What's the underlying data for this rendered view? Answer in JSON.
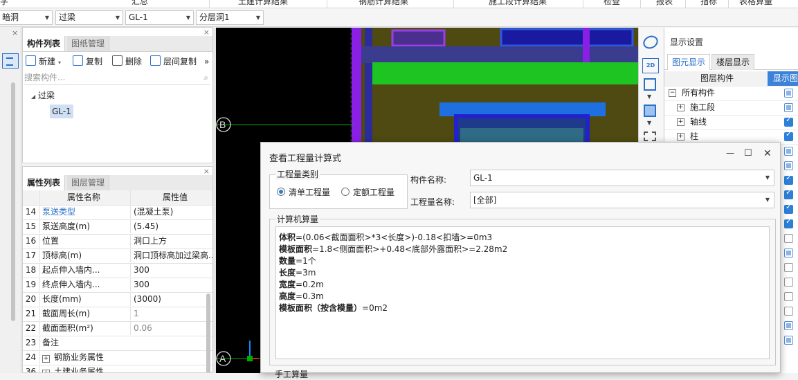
{
  "top_tabs": [
    "汇总",
    "土建计算结果",
    "钢筋计算结果",
    "施工段计算结果",
    "检查",
    "报表",
    "指标",
    "表格算量"
  ],
  "selectors": {
    "floor_type": "暗洞",
    "element_type": "过梁",
    "element_name": "GL-1",
    "layer": "分层洞1"
  },
  "component_panel": {
    "tabs": [
      "构件列表",
      "图纸管理"
    ],
    "toolbar": {
      "new": "新建",
      "copy": "复制",
      "delete": "删除",
      "layer_copy": "层间复制",
      "more": "»"
    },
    "search_placeholder": "搜索构件...",
    "tree_root": "过梁",
    "tree_item": "GL-1",
    "close": "×"
  },
  "property_panel": {
    "tabs": [
      "属性列表",
      "图层管理"
    ],
    "header": {
      "name": "属性名称",
      "value": "属性值"
    },
    "rows": [
      {
        "num": "14",
        "name": "泵送类型",
        "value": "(混凝土泵)"
      },
      {
        "num": "15",
        "name": "泵送高度(m)",
        "value": "(5.45)"
      },
      {
        "num": "16",
        "name": "位置",
        "value": "洞口上方"
      },
      {
        "num": "17",
        "name": "顶标高(m)",
        "value": "洞口顶标高加过梁高..."
      },
      {
        "num": "18",
        "name": "起点伸入墙内...",
        "value": "300"
      },
      {
        "num": "19",
        "name": "终点伸入墙内...",
        "value": "300"
      },
      {
        "num": "20",
        "name": "长度(mm)",
        "value": "(3000)"
      },
      {
        "num": "21",
        "name": "截面周长(m)",
        "value": "1"
      },
      {
        "num": "22",
        "name": "截面面积(m²)",
        "value": "0.06"
      },
      {
        "num": "23",
        "name": "备注",
        "value": ""
      },
      {
        "num": "24",
        "name": "钢筋业务属性",
        "value": ""
      },
      {
        "num": "36",
        "name": "土建业务属性",
        "value": ""
      }
    ],
    "close": "×"
  },
  "canvas": {
    "axis_b": "B",
    "axis_a": "A"
  },
  "view_icons": [
    "orbit-icon",
    "2d-icon",
    "3d-box-icon",
    "3d-solid-icon",
    "select-region-icon"
  ],
  "view_2d_label": "2D",
  "display_panel": {
    "title": "显示设置",
    "tabs": [
      "图元显示",
      "楼层显示"
    ],
    "header": {
      "layer": "图层构件",
      "show": "显示图"
    },
    "rows": [
      {
        "label": "所有构件",
        "expander": "−"
      },
      {
        "label": "施工段",
        "expander": "+"
      },
      {
        "label": "轴线",
        "expander": "+"
      },
      {
        "label": "柱",
        "expander": "+"
      }
    ],
    "checkboxes": [
      "sq",
      "sq",
      "on",
      "on",
      "sq",
      "sq",
      "on",
      "on",
      "on",
      "on",
      "off",
      "sq",
      "off",
      "off",
      "off",
      "off",
      "sq",
      "sq"
    ]
  },
  "dialog": {
    "title": "查看工程量计算式",
    "controls": {
      "minimize": "—",
      "maximize": "☐",
      "close": "✕"
    },
    "qty_type_group": "工程量类别",
    "radio_bill": "清单工程量",
    "radio_quota": "定额工程量",
    "component_name_label": "构件名称:",
    "component_name_value": "GL-1",
    "qty_name_label": "工程量名称:",
    "qty_name_value": "[全部]",
    "computer_qty_label": "计算机算量",
    "formulas": [
      {
        "key": "体积",
        "rest": "=(0.06<截面面积>*3<长度>)-0.18<扣墙>=0m3"
      },
      {
        "key": "模板面积",
        "rest": "=1.8<侧面面积>+0.48<底部外露面积>=2.28m2"
      },
      {
        "key": "数量",
        "rest": "=1个"
      },
      {
        "key": "长度",
        "rest": "=3m"
      },
      {
        "key": "宽度",
        "rest": "=0.2m"
      },
      {
        "key": "高度",
        "rest": "=0.3m"
      },
      {
        "key": "模板面积（按含模量）",
        "rest": "=0m2"
      }
    ],
    "manual_qty_label": "手工算量"
  }
}
